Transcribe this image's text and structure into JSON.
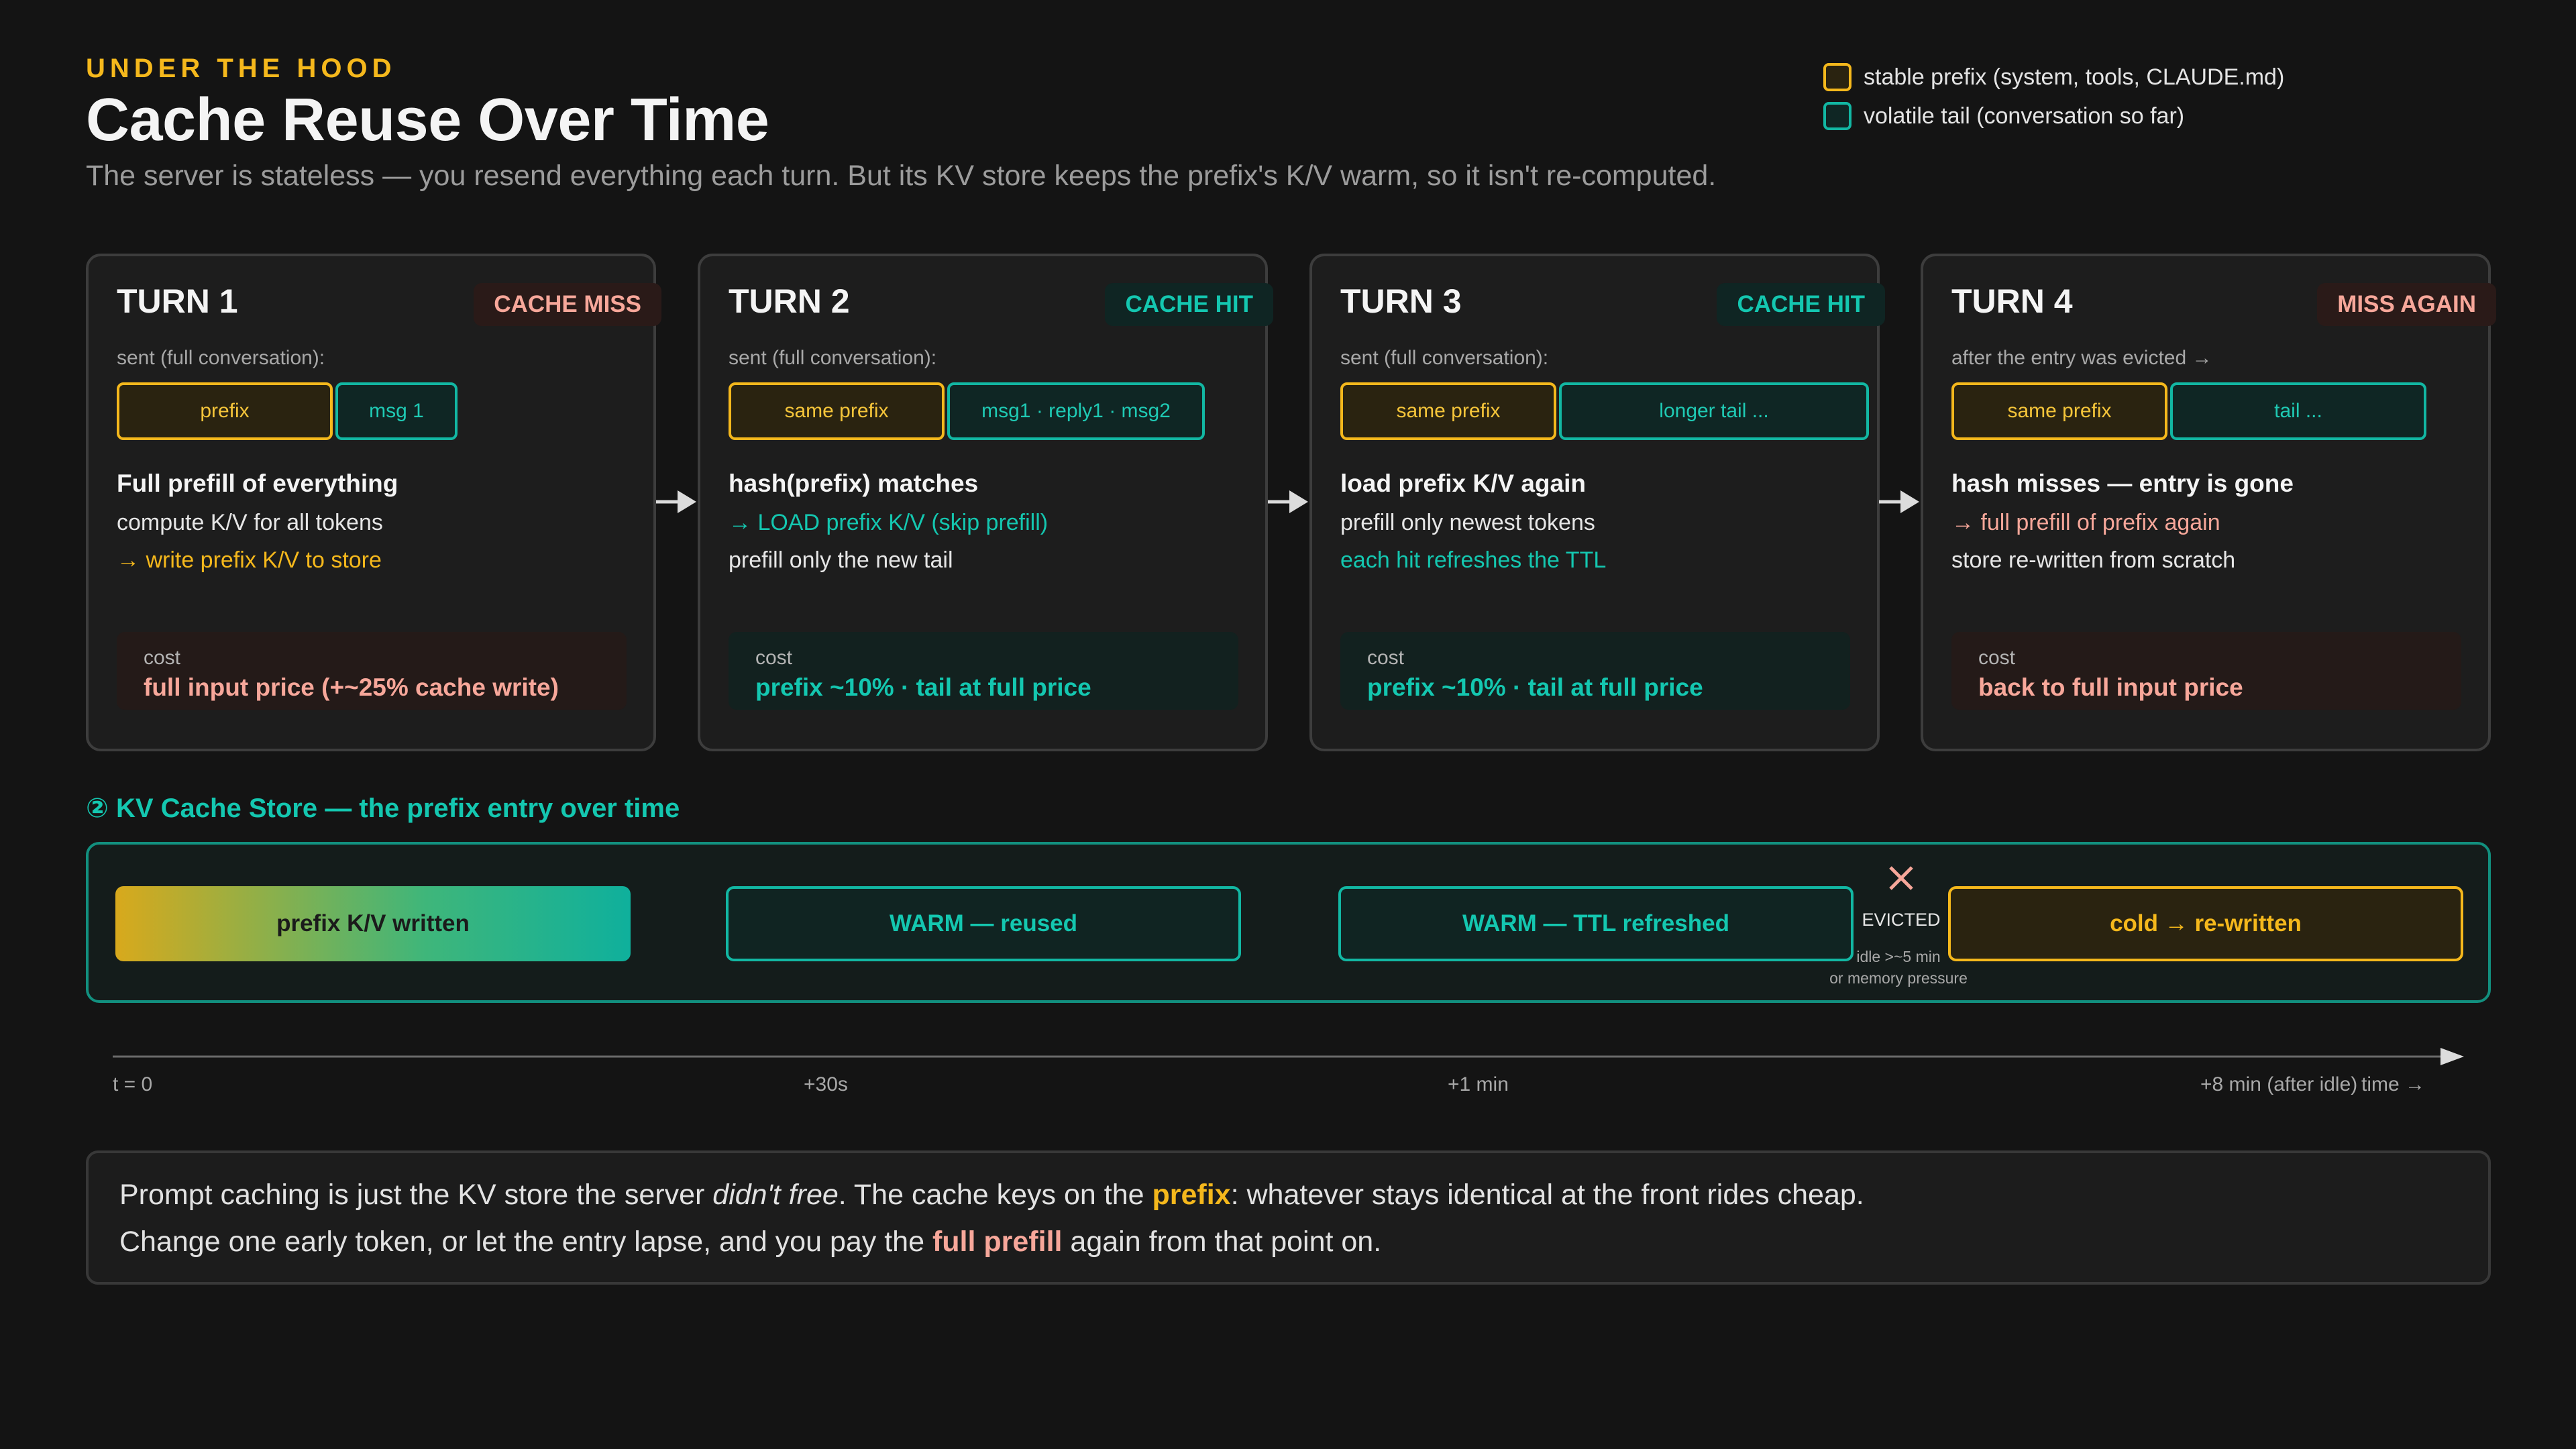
{
  "header": {
    "eyebrow": "UNDER THE HOOD",
    "title": "Cache Reuse Over Time",
    "subtitle": "The server is stateless — you resend everything each turn. But its KV store keeps the prefix's K/V warm, so it isn't re-computed."
  },
  "legend": {
    "stable": "stable prefix (system, tools, CLAUDE.md)",
    "volatile": "volatile tail (conversation so far)"
  },
  "colors": {
    "stable": "#f5b81c",
    "volatile": "#12b7a3",
    "miss": "#f7a79a",
    "background": "#141414"
  },
  "turns": [
    {
      "title": "TURN 1",
      "badge": "CACHE MISS",
      "sent": "sent (full conversation):",
      "prefix_chip": "prefix",
      "tail_chip": "msg 1",
      "head": "Full prefill of everything",
      "line1": "compute K/V for all tokens",
      "line2": "→ write prefix K/V to store",
      "cost_label": "cost",
      "cost_value": "full input price (+~25% cache write)"
    },
    {
      "title": "TURN 2",
      "badge": "CACHE HIT",
      "sent": "sent (full conversation):",
      "prefix_chip": "same prefix",
      "tail_chip": "msg1 · reply1 · msg2",
      "head": "hash(prefix) matches",
      "line1": "→ LOAD prefix K/V (skip prefill)",
      "line2": "prefill only the new tail",
      "cost_label": "cost",
      "cost_value": "prefix ~10% · tail at full price"
    },
    {
      "title": "TURN 3",
      "badge": "CACHE HIT",
      "sent": "sent (full conversation):",
      "prefix_chip": "same prefix",
      "tail_chip": "longer tail ...",
      "head": "load prefix K/V again",
      "line1": "prefill only newest tokens",
      "line2": "each hit refreshes the TTL",
      "cost_label": "cost",
      "cost_value": "prefix ~10% · tail at full price"
    },
    {
      "title": "TURN 4",
      "badge": "MISS AGAIN",
      "sent": "after the entry was evicted →",
      "prefix_chip": "same prefix",
      "tail_chip": "tail ...",
      "head": "hash misses — entry is gone",
      "line1": "→ full prefill of prefix again",
      "line2": "store re-written from scratch",
      "cost_label": "cost",
      "cost_value": "back to full input price"
    }
  ],
  "store": {
    "title": "② KV Cache Store — the prefix entry over time",
    "seg1": "prefix K/V written",
    "seg2": "WARM — reused",
    "seg3": "WARM — TTL refreshed",
    "seg4": "cold → re-written",
    "evicted": "EVICTED",
    "evict_note1": "idle >~5 min",
    "evict_note2": "or memory pressure",
    "evict_icon": "close-icon"
  },
  "timeline": {
    "t0": "t = 0",
    "t1": "+30s",
    "t2": "+1 min",
    "t3": "+8 min (after idle)",
    "axis": "time →"
  },
  "footer": {
    "l1_a": "Prompt caching is just the KV store the server ",
    "l1_b": "didn't free",
    "l1_c": ". The cache keys on the ",
    "l1_d": "prefix",
    "l1_e": ": whatever stays identical at the front rides cheap.",
    "l2_a": "Change one early token, or let the entry lapse, and you pay the ",
    "l2_b": "full prefill",
    "l2_c": " again from that point on."
  }
}
